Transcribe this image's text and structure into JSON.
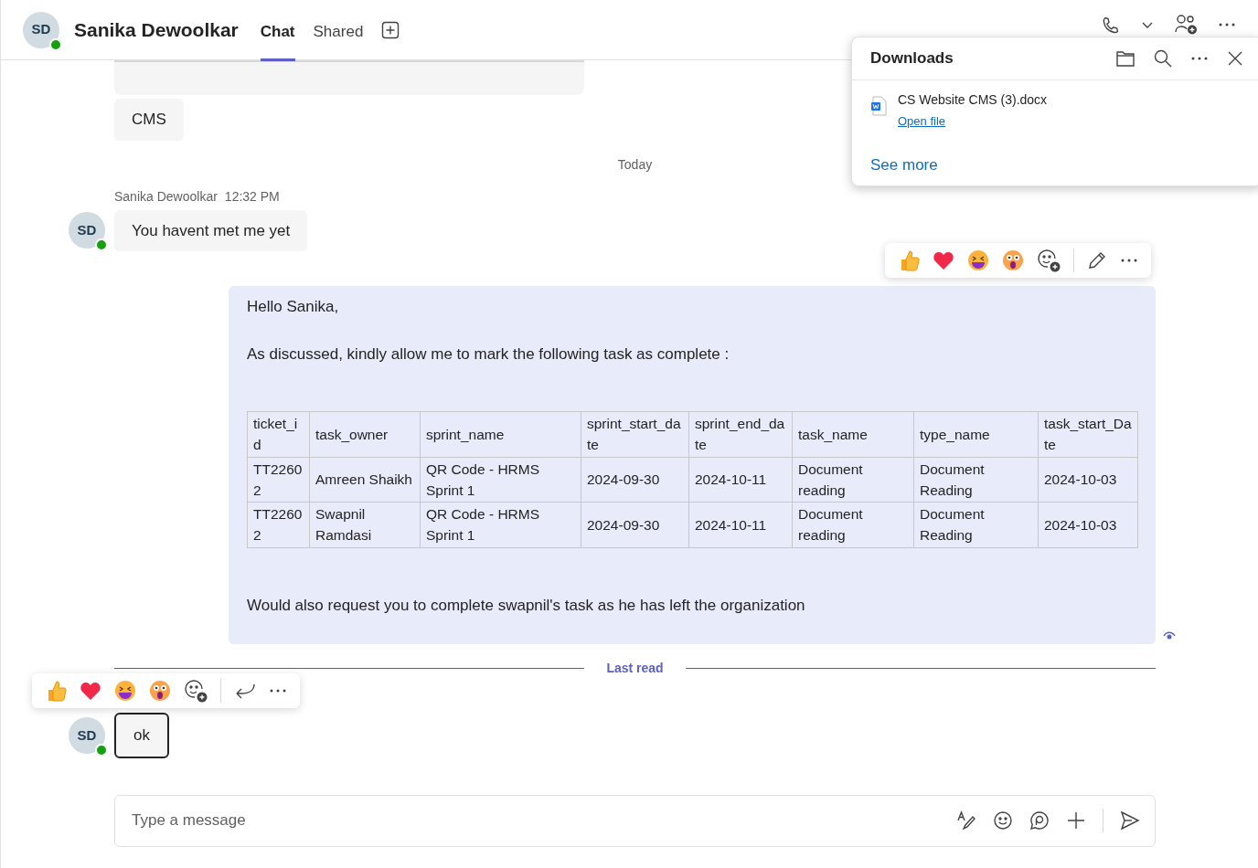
{
  "header": {
    "avatar": {
      "initials": "SD",
      "online": true
    },
    "name": "Sanika Dewoolkar",
    "tabs": [
      {
        "label": "Chat",
        "selected": true
      },
      {
        "label": "Shared",
        "selected": false
      }
    ]
  },
  "messages": [
    {
      "kind": "cut"
    },
    {
      "kind": "theirs_cont",
      "text": "CMS"
    },
    {
      "kind": "date",
      "text": "Today"
    },
    {
      "kind": "theirs",
      "sender": "Sanika Dewoolkar",
      "time": "12:32 PM",
      "avatar": {
        "initials": "SD",
        "online": true
      },
      "text": "You havent met me yet"
    },
    {
      "kind": "mine",
      "reactions_bar": true,
      "greeting": "Hello Sanika,",
      "intro": "As discussed, kindly allow me to mark the following task as complete :",
      "table": {
        "columns": [
          "ticket_id",
          "task_owner",
          "sprint_name",
          "sprint_start_date",
          "sprint_end_date",
          "task_name",
          "type_name",
          "task_start_Date"
        ],
        "rows": [
          [
            "TT22602",
            "Amreen Shaikh",
            "QR Code - HRMS Sprint 1",
            "2024-09-30",
            "2024-10-11",
            "Document reading",
            "Document Reading",
            "2024-10-03"
          ],
          [
            "TT22602",
            "Swapnil Ramdasi",
            "QR Code - HRMS Sprint 1",
            "2024-09-30",
            "2024-10-11",
            "Document reading",
            "Document Reading",
            "2024-10-03"
          ]
        ]
      },
      "closing": "Would also request you to complete swapnil's task as he has left the organization",
      "seen": true
    },
    {
      "kind": "lastread",
      "text": "Last read"
    },
    {
      "kind": "theirs",
      "avatar": {
        "initials": "SD",
        "online": true
      },
      "text": "ok",
      "focused": true,
      "reactions_bar": true
    }
  ],
  "composer": {
    "placeholder": "Type a message"
  },
  "downloads": {
    "title": "Downloads",
    "files": [
      {
        "name": "CS Website CMS (3).docx",
        "action": "Open file"
      }
    ],
    "see_more": "See more"
  }
}
